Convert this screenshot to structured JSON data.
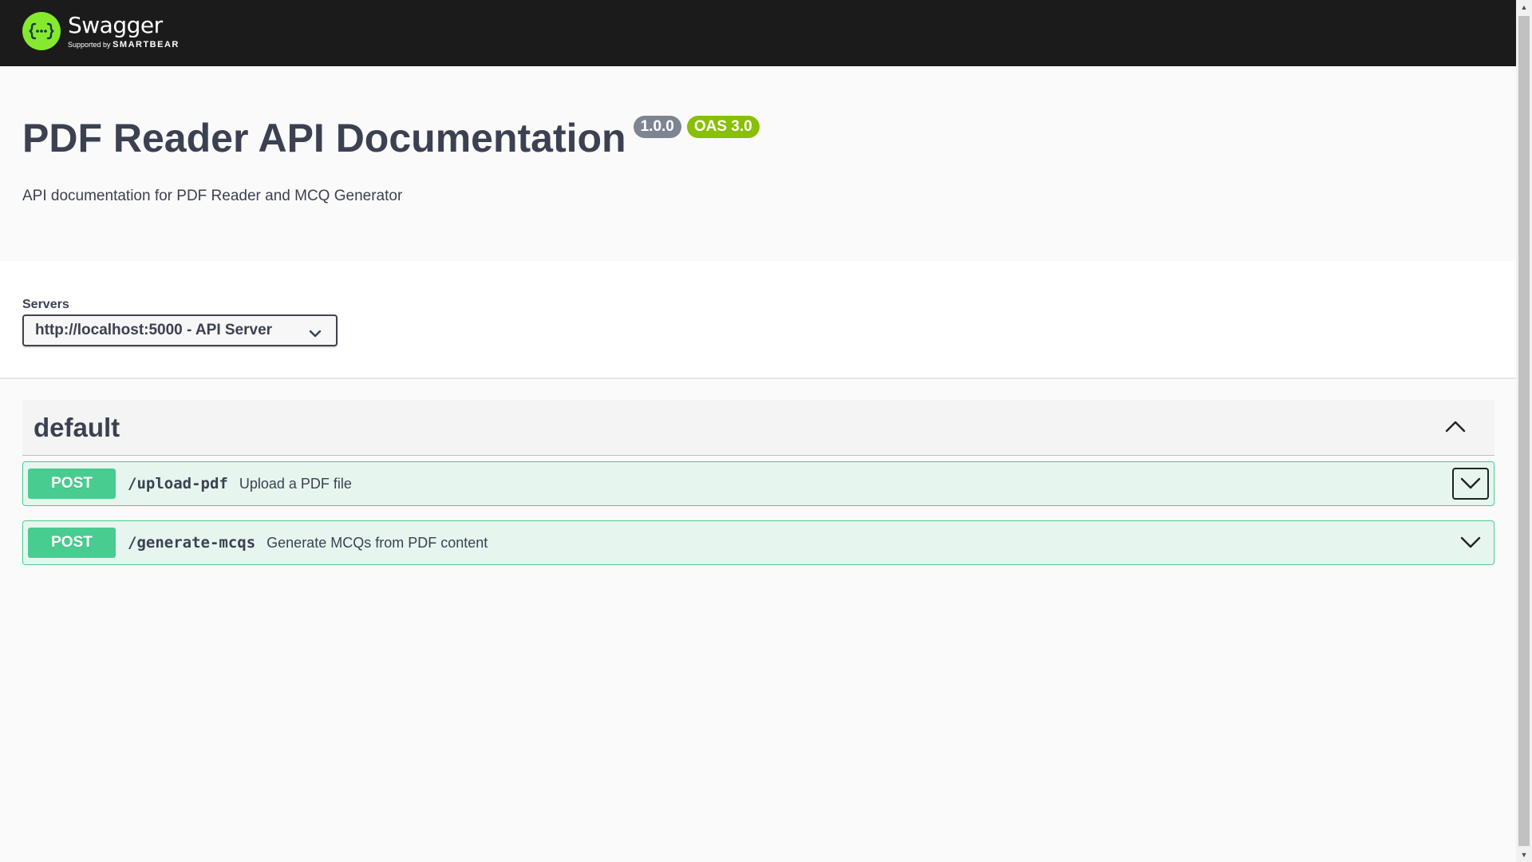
{
  "topbar": {
    "logo_name": "Swagger",
    "logo_sub_prefix": "Supported by",
    "logo_sub_brand": "SMARTBEAR",
    "logo_icon": "swagger-braces-icon",
    "logo_color": "#85ea2d"
  },
  "info": {
    "title": "PDF Reader API Documentation",
    "version_badge": "1.0.0",
    "oas_badge": "OAS 3.0",
    "description": "API documentation for PDF Reader and MCQ Generator"
  },
  "servers": {
    "label": "Servers",
    "selected": "http://localhost:5000 - API Server"
  },
  "tag": {
    "name": "default",
    "expanded": true
  },
  "operations": [
    {
      "method": "POST",
      "path": "/upload-pdf",
      "summary": "Upload a PDF file",
      "color": "#49cc90"
    },
    {
      "method": "POST",
      "path": "/generate-mcqs",
      "summary": "Generate MCQs from PDF content",
      "color": "#49cc90"
    }
  ],
  "colors": {
    "topbar_bg": "#1b1b1b",
    "text": "#3b4151",
    "version_badge": "#7d8492",
    "oas_badge": "#89bf04",
    "post": "#49cc90"
  }
}
